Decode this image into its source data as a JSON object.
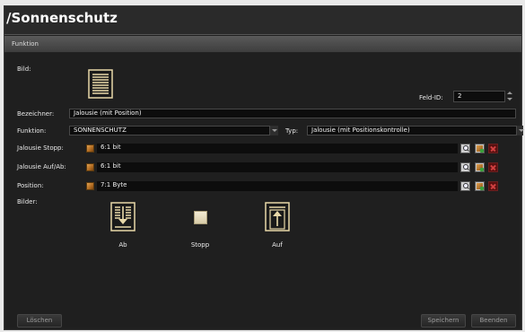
{
  "window": {
    "title": "/Sonnenschutz"
  },
  "section": {
    "title": "Funktion"
  },
  "form": {
    "bild_label": "Bild:",
    "feld_id_label": "Feld-ID:",
    "feld_id_value": "2",
    "bezeichner_label": "Bezeichner:",
    "bezeichner_value": "Jalousie (mit Position)",
    "funktion_label": "Funktion:",
    "funktion_value": "SONNENSCHUTZ",
    "typ_label": "Typ:",
    "typ_value": "Jalousie (mit Positionskontrolle)",
    "rows": [
      {
        "label": "Jalousie Stopp:",
        "value": "6:1 bit"
      },
      {
        "label": "Jalousie Auf/Ab:",
        "value": "6:1 bit"
      },
      {
        "label": "Position:",
        "value": "7:1 Byte"
      }
    ],
    "bilder_label": "Bilder:",
    "pictures": [
      {
        "label": "Ab"
      },
      {
        "label": "Stopp"
      },
      {
        "label": "Auf"
      }
    ]
  },
  "buttons": {
    "loeschen": "Löschen",
    "speichern": "Speichern",
    "beenden": "Beenden"
  },
  "icons": {
    "blind_icon": "window-blind-icon",
    "down_icon": "blind-down-icon",
    "stop_icon": "stop-square-icon",
    "up_icon": "blind-up-icon"
  },
  "colors": {
    "background": "#1f1f1f",
    "field": "#0d0d0d",
    "accent_icon": "#e8d8a8"
  }
}
